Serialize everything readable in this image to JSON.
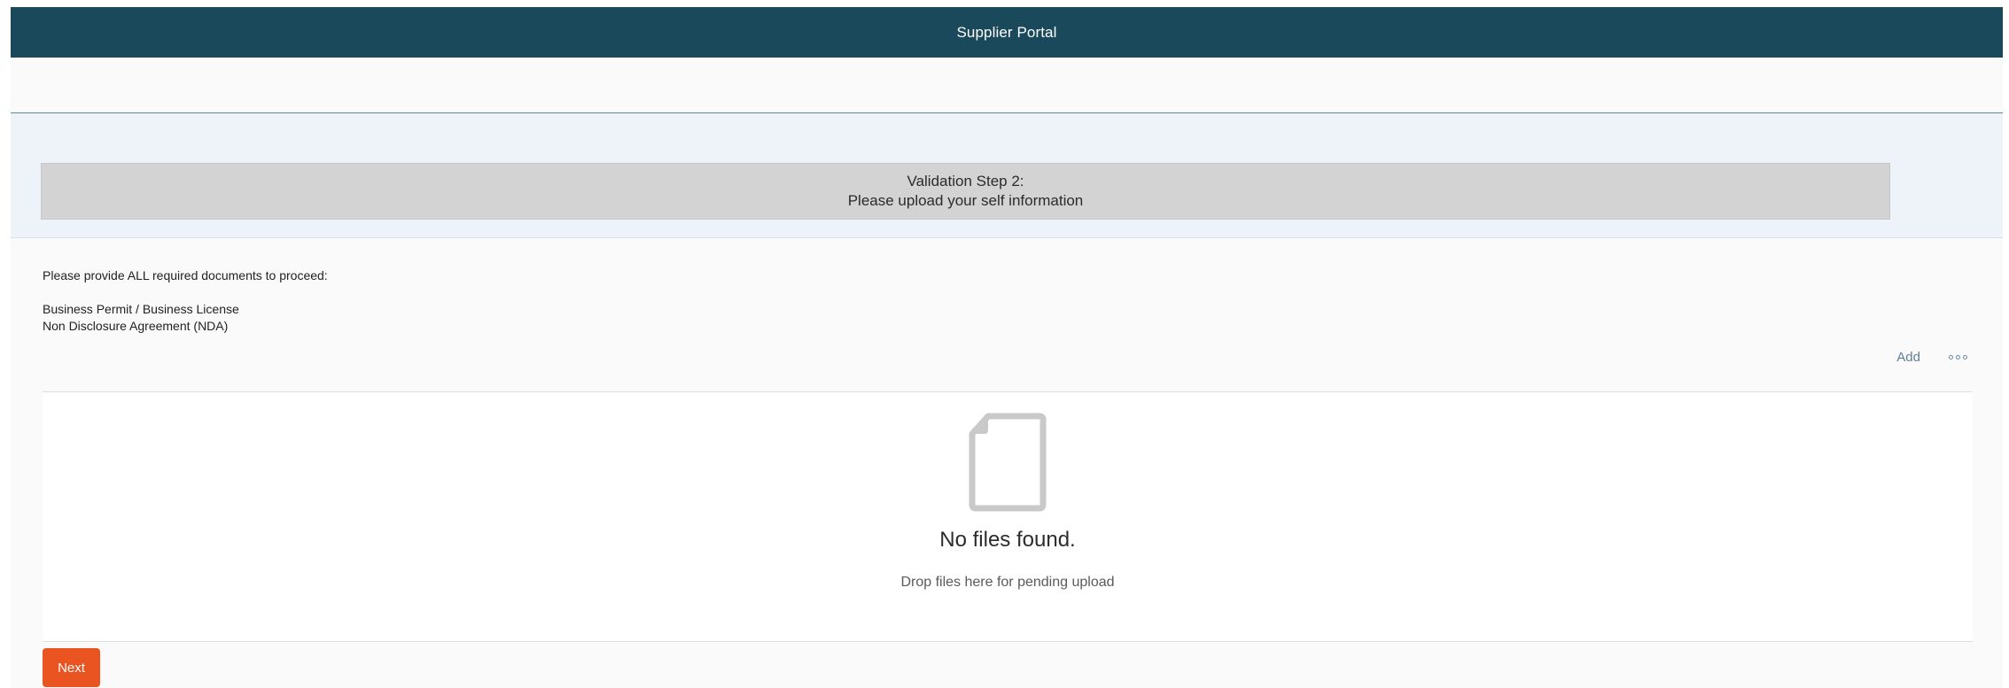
{
  "shellbar": {
    "title": "Supplier Portal"
  },
  "validation_step": {
    "line1": "Validation Step 2:",
    "line2": "Please upload your self information"
  },
  "instructions": {
    "lead": "Please provide ALL required documents to proceed:",
    "documents": [
      "Business Permit / Business License",
      "Non Disclosure Agreement (NDA)"
    ]
  },
  "toolbar": {
    "add_label": "Add",
    "more_icon": "overflow-menu-icon"
  },
  "upload": {
    "icon": "document-icon",
    "empty_title": "No files found.",
    "empty_subtitle": "Drop files here for pending upload"
  },
  "actions": {
    "next_label": "Next"
  },
  "colors": {
    "shellbar": "#19495b",
    "accent_button": "#e95420",
    "link": "#5f7f98"
  }
}
